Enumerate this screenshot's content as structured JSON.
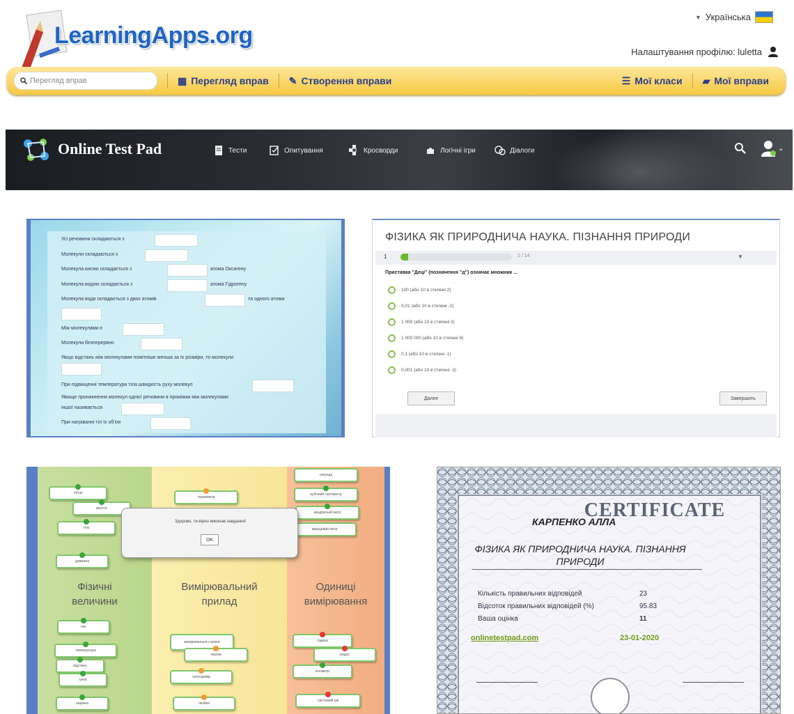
{
  "learningapps": {
    "logo_text": "LearningApps.org",
    "language": "Українська",
    "profile_label": "Налаштування профілю: luletta",
    "search_placeholder": "Перегляд вправ",
    "nav": {
      "browse": "Перегляд вправ",
      "create": "Створення вправи",
      "classes": "Мої класи",
      "exercises": "Мої вправи"
    },
    "colors": {
      "bar": "#f7c943",
      "text": "#2a3e8c",
      "logo": "#1e63c7"
    }
  },
  "onlinetestpad": {
    "logo_text": "Online Test Pad",
    "nav": [
      "Тести",
      "Опитування",
      "Кросворди",
      "Логічні ігри",
      "Діалоги"
    ],
    "icons": [
      "document-icon",
      "checklist-icon",
      "crossword-icon",
      "puzzle-icon",
      "chat-icon",
      "search-icon",
      "user-icon"
    ]
  },
  "fill_exercise": {
    "lines": [
      "Усі речовини складаються з",
      "Молекули складаються з",
      "Молекула кисню складається з",
      "Молекула водню складається з",
      "Молекула води складається з двох атомів",
      "",
      "Між молекулами є",
      "Молекули безперервно",
      "Якщо відстань між молекулами помітніше менша за їх розміри, то молекули",
      "",
      "При підвищенні температури тіла швидкість руху молекул",
      "Явище проникнення молекул однієї речовини в проміжки між молекулами",
      "іншої називається",
      "При нагріванні тіл їх об'єм"
    ],
    "suffixes": {
      "oxygen": "атома Оксигену",
      "hydrogen": "атома Гідрогену",
      "water": "та одного атома"
    }
  },
  "test": {
    "title": "ФІЗИКА ЯК ПРИРОДНИЧА НАУКА. ПІЗНАННЯ ПРИРОДИ",
    "question_number": "1",
    "progress_text": "1 / 14",
    "progress_fraction": 0.07,
    "question": "Приставка \"Деці\" (позначення \"д\") означає множник ...",
    "options": [
      "100 (або 10 в степені 2)",
      "0,01 (або 10 в степені -2)",
      "1 000 (або 10 в степені 3)",
      "1 000 000 (або 10 в степені 6)",
      "0,1 (або 10 в степені -1)",
      "0,001 (або 10 в степені -3)"
    ],
    "next_button": "Далее",
    "finish_button": "Завершить"
  },
  "sorting": {
    "columns": [
      {
        "title_1": "Фізичні",
        "title_2": "величини"
      },
      {
        "title_1": "Вимірювальний",
        "title_2": "прилад"
      },
      {
        "title_1": "Одиниці",
        "title_2": "вимірювання"
      }
    ],
    "cards": {
      "c1": [
        "об'єм",
        "висота",
        "тіло",
        "довжина",
        "час",
        "температура",
        "відстань",
        "сила",
        "ширина"
      ],
      "c2": [
        "термометр",
        "вимірювальна стрічка",
        "терези",
        "секундомір",
        "лінійка"
      ],
      "c3": [
        "секунда",
        "кубічний сантиметр",
        "квадратний метр",
        "кварцевий метр",
        "година",
        "градус",
        "кілометр",
        "світловий рік"
      ]
    },
    "dialog_message": "Здорово, ти вірно виконав завдання!",
    "ok_button": "OK"
  },
  "certificate": {
    "heading": "CERTIFICATE",
    "name": "КАРПЕНКО АЛЛА",
    "subject_1": "ФІЗИКА ЯК ПРИРОДНИЧА НАУКА. ПІЗНАННЯ",
    "subject_2": "ПРИРОДИ",
    "stats": [
      {
        "label": "Кількість правильних відповідей",
        "value": "23"
      },
      {
        "label": "Відсоток правильних відповідей (%)",
        "value": "95.83"
      },
      {
        "label": "Ваша оцінка",
        "value": "11"
      }
    ],
    "site": "onlinetestpad.com",
    "date": "23-01-2020"
  }
}
